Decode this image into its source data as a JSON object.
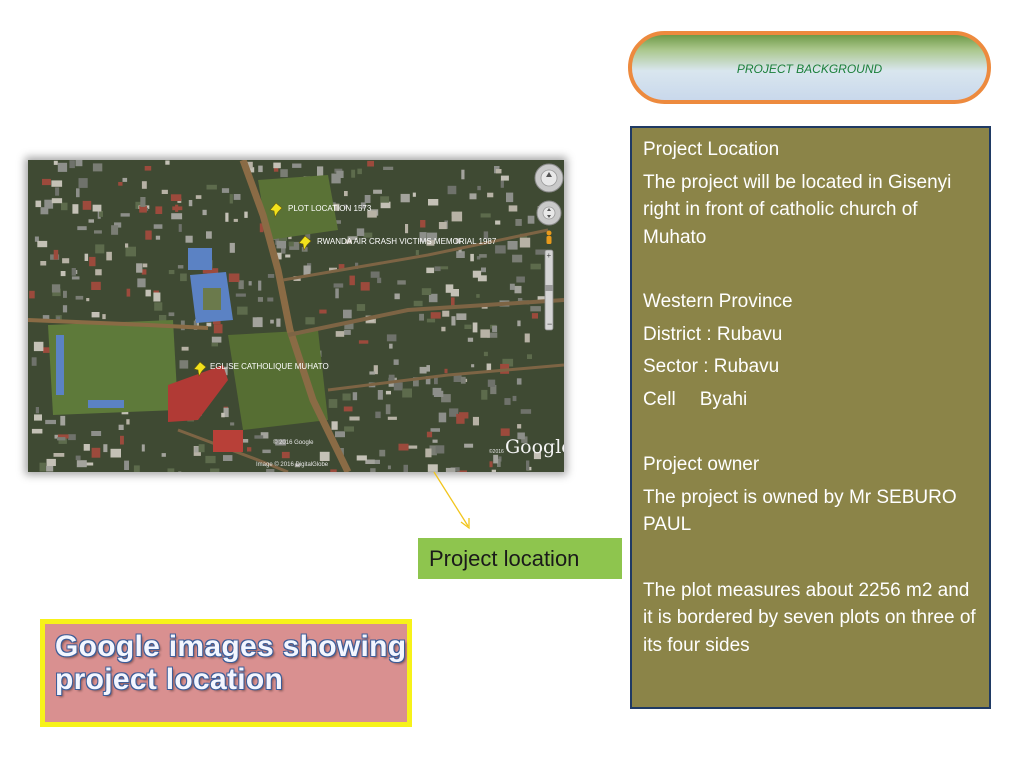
{
  "header": {
    "title": "PROJECT BACKGROUND"
  },
  "map": {
    "labels": {
      "plot": "PLOT LOCATION 1573",
      "memorial": "RWANDA AIR CRASH VICTIMS MEMORIAL 1987",
      "church": "EGLISE CATHOLIQUE MUHATO"
    },
    "copyright": "© 2016 Google",
    "imagery": "Image © 2016 DigitalGlobe",
    "watermark_small": "©2016",
    "watermark": "Google"
  },
  "info": {
    "location_heading": "Project Location",
    "location_text": "The project  will be located in Gisenyi right in front of catholic church of Muhato",
    "province": "Western Province",
    "district": "District : Rubavu",
    "sector": "Sector : Rubavu",
    "cell_label": "Cell",
    "cell_value": "Byahi",
    "owner_heading": "Project owner",
    "owner_text": "The project is owned by Mr SEBURO PAUL",
    "plot_text": "The plot measures about 2256 m2 and it is bordered by seven plots  on three of its four sides"
  },
  "location_label": "Project location",
  "caption": {
    "line1": "Google images showing",
    "line2": "project location"
  },
  "colors": {
    "pill_border": "#ed8a3e",
    "info_background": "#8b8448",
    "info_border": "#1f3a64",
    "label_green": "#8ec54e",
    "caption_background": "#d99090",
    "caption_border": "#f7f21a"
  }
}
